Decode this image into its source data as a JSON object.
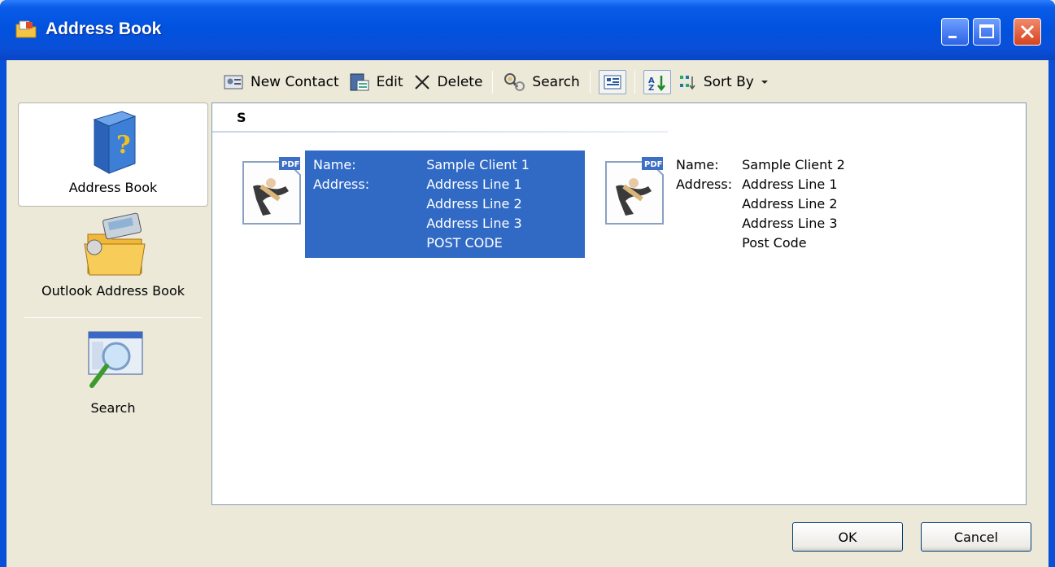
{
  "window": {
    "title": "Address Book"
  },
  "toolbar": {
    "new_contact": "New Contact",
    "edit": "Edit",
    "delete": "Delete",
    "search": "Search",
    "sort_by": "Sort By"
  },
  "nav": {
    "items": [
      {
        "label": "Address Book",
        "icon": "address-book-icon",
        "selected": true
      },
      {
        "label": "Outlook Address Book",
        "icon": "outlook-address-book-icon",
        "selected": false
      },
      {
        "label": "Search",
        "icon": "search-icon",
        "selected": false
      }
    ]
  },
  "list": {
    "group_letter": "S",
    "field_labels": {
      "name": "Name:",
      "address": "Address:"
    },
    "contacts": [
      {
        "name": "Sample Client 1",
        "address": [
          "Address Line 1",
          "Address Line 2",
          "Address Line 3",
          "POST CODE"
        ],
        "selected": true
      },
      {
        "name": "Sample Client 2",
        "address": [
          "Address Line 1",
          "Address Line 2",
          "Address Line 3",
          "Post Code"
        ],
        "selected": false
      }
    ]
  },
  "buttons": {
    "ok": "OK",
    "cancel": "Cancel"
  },
  "colors": {
    "title_bar": "#0a4fd8",
    "selection": "#316ac5",
    "face": "#ece9d8"
  }
}
